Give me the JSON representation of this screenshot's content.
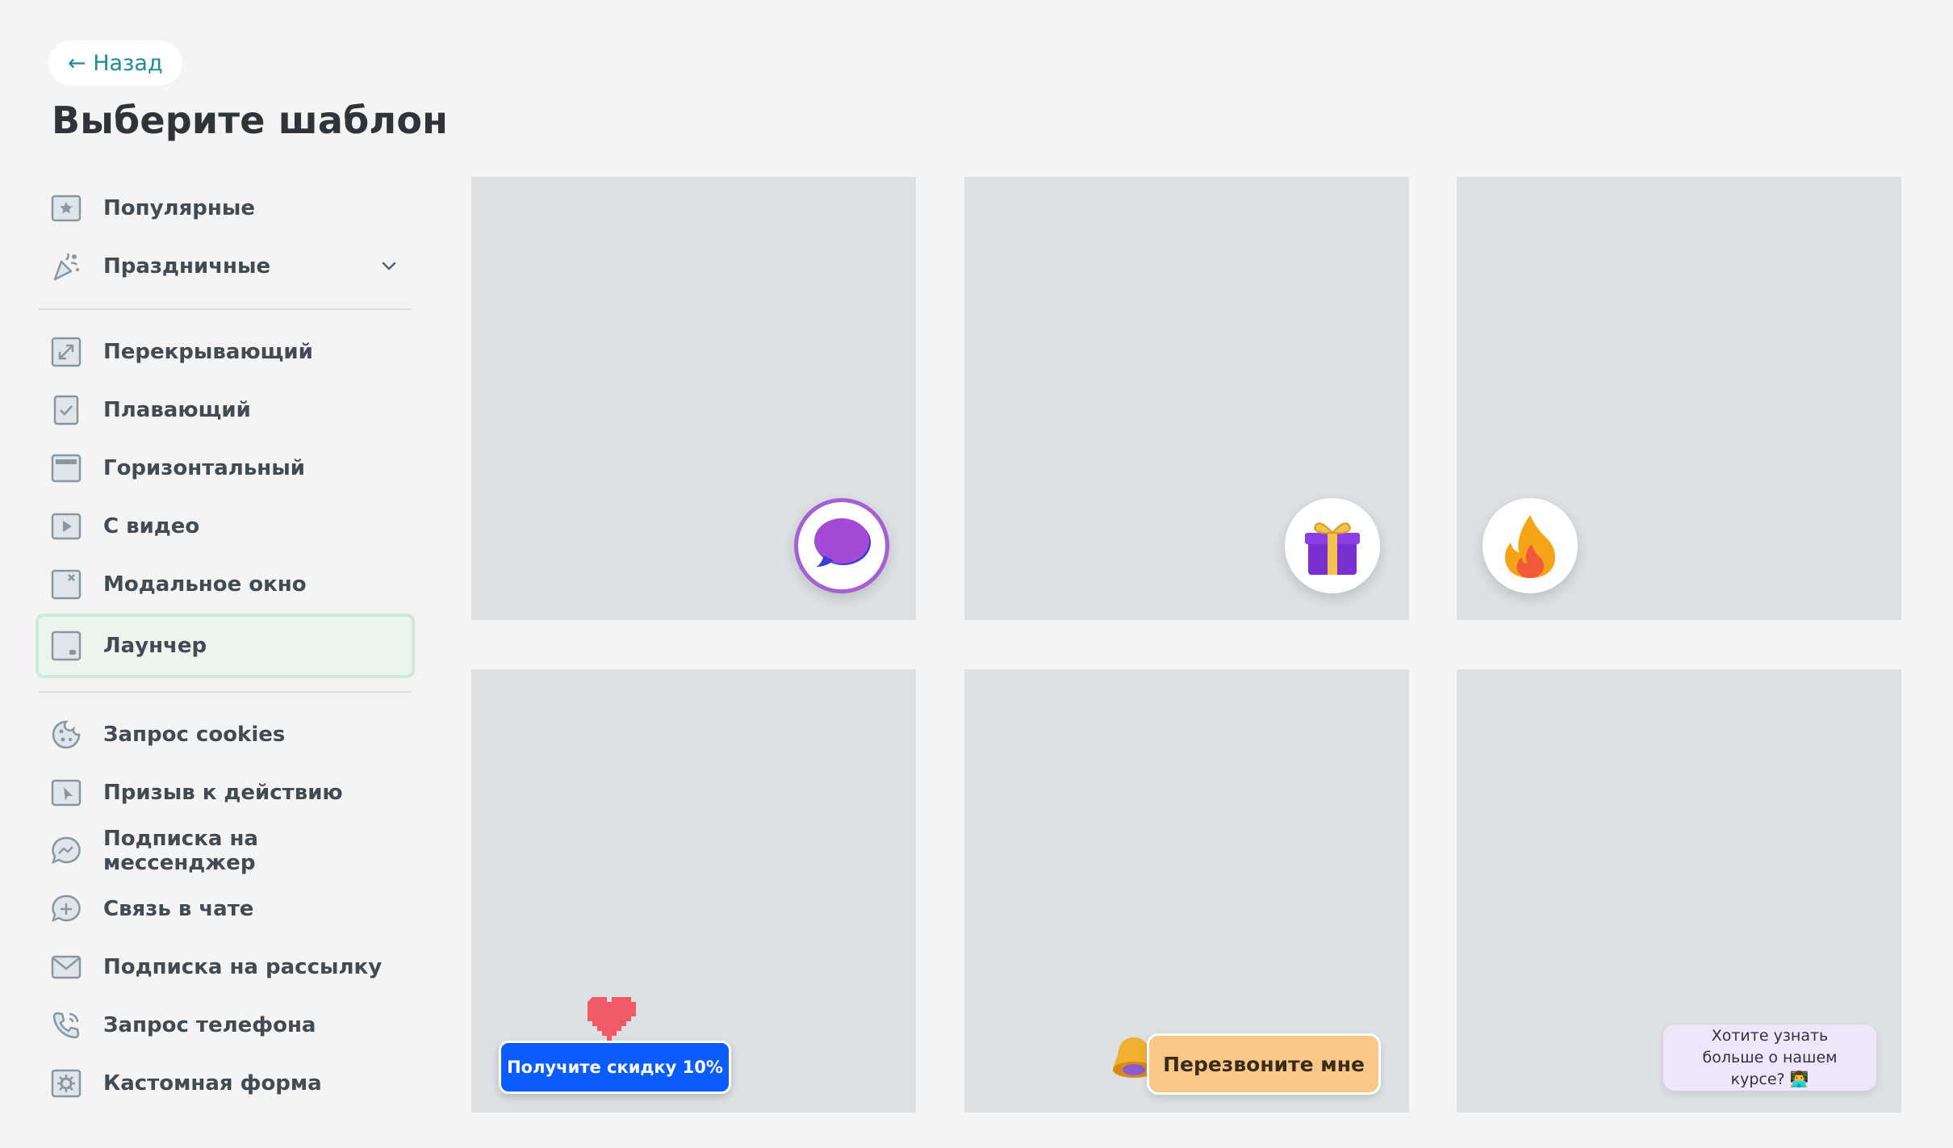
{
  "back_label": "← Назад",
  "page_title": "Выберите шаблон",
  "sidebar": {
    "group1": [
      {
        "label": "Популярные",
        "icon": "star-icon"
      },
      {
        "label": "Праздничные",
        "icon": "party-popper-icon"
      }
    ],
    "group2": [
      {
        "label": "Перекрывающий",
        "icon": "expand-icon"
      },
      {
        "label": "Плавающий",
        "icon": "floating-check-icon"
      },
      {
        "label": "Горизонтальный",
        "icon": "horizontal-bar-icon"
      },
      {
        "label": "С видео",
        "icon": "video-icon"
      },
      {
        "label": "Модальное окно",
        "icon": "modal-close-icon"
      },
      {
        "label": "Лаунчер",
        "icon": "launcher-icon",
        "active": true
      }
    ],
    "group3": [
      {
        "label": "Запрос cookies",
        "icon": "cookie-icon"
      },
      {
        "label": "Призыв к действию",
        "icon": "cursor-click-icon"
      },
      {
        "label": "Подписка на мессенджер",
        "icon": "messenger-icon"
      },
      {
        "label": "Связь в чате",
        "icon": "chat-plus-icon"
      },
      {
        "label": "Подписка на рассылку",
        "icon": "envelope-icon"
      },
      {
        "label": "Запрос телефона",
        "icon": "phone-icon"
      },
      {
        "label": "Кастомная форма",
        "icon": "gear-icon"
      }
    ]
  },
  "templates": {
    "discount_button": "Получите скидку 10%",
    "callback_button": "Перезвоните мне",
    "course_tooltip": "Хотите узнать больше о нашем курсе? 👨‍💻"
  },
  "colors": {
    "accent_link": "#1f8a9a",
    "active_bg": "#ecf4ee",
    "active_border": "#cfe8d7",
    "card_bg": "#dde1e4",
    "blue_button": "#0a5cff",
    "orange_button": "#f9c887",
    "lilac_tooltip": "#efe6fb"
  }
}
